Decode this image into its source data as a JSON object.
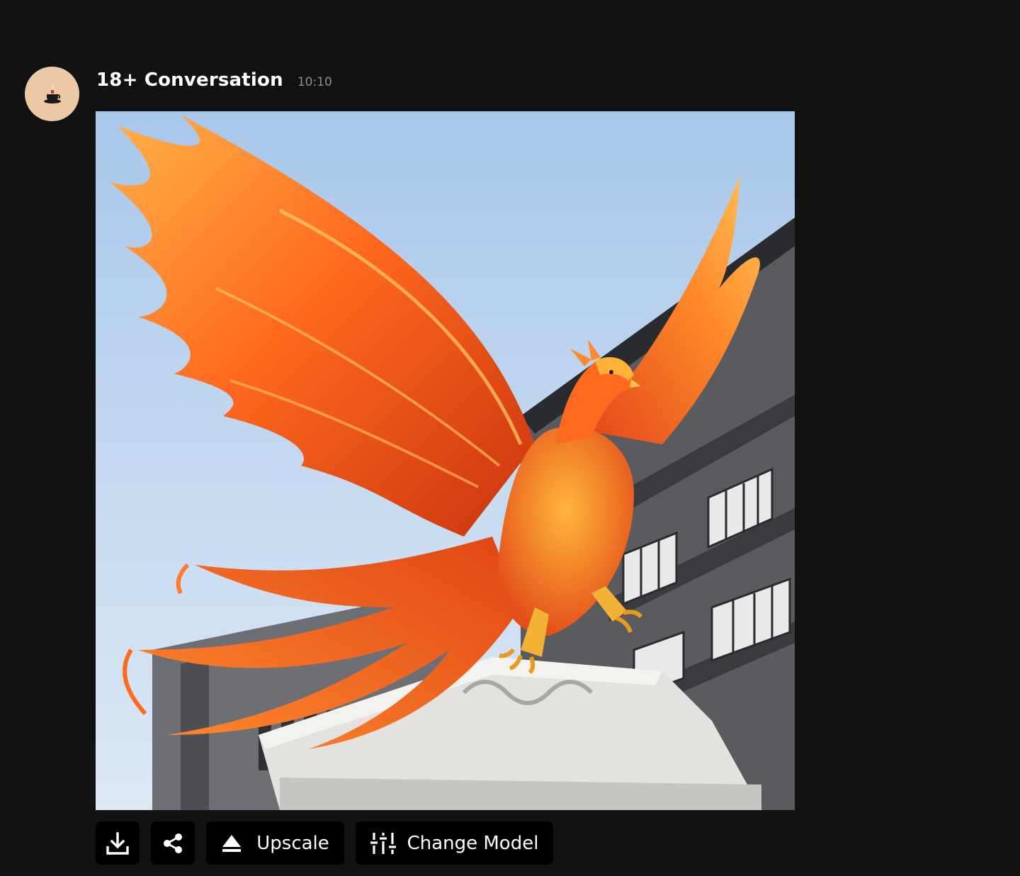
{
  "message": {
    "sender": "18+ Conversation",
    "time": "10:10",
    "avatar_icon": "teacup-icon",
    "image_subject": "phoenix"
  },
  "actions": {
    "download_icon": "download-icon",
    "share_icon": "share-icon",
    "upscale_label": "Upscale",
    "upscale_icon": "eject-icon",
    "change_model_label": "Change Model",
    "change_model_icon": "sliders-icon"
  },
  "colors": {
    "background": "#121212",
    "avatar_bg": "#ebc8a6",
    "button_bg": "#000000",
    "timestamp": "#8f8f8f"
  }
}
